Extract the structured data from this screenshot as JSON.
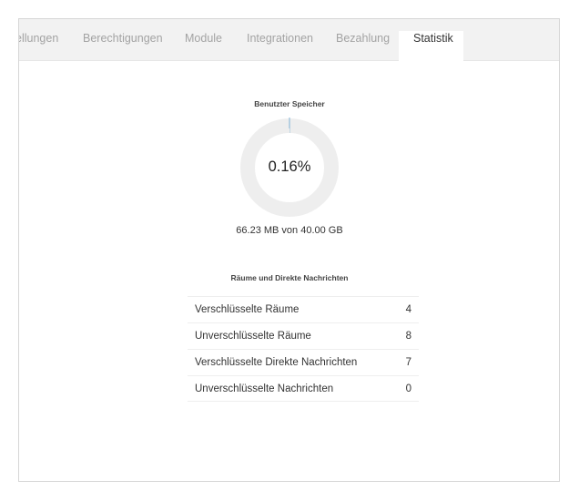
{
  "tabs": [
    {
      "label": "ellungen",
      "active": false
    },
    {
      "label": "Berechtigungen",
      "active": false
    },
    {
      "label": "Module",
      "active": false
    },
    {
      "label": "Integrationen",
      "active": false
    },
    {
      "label": "Bezahlung",
      "active": false
    },
    {
      "label": "Statistik",
      "active": true
    }
  ],
  "storage": {
    "title": "Benutzter Speicher",
    "percent_label": "0.16%",
    "percent_value": 0.16,
    "usage_text": "66.23 MB von 40.00 GB",
    "track_color": "#eeeeee",
    "fill_color": "#7fb3d5"
  },
  "rooms": {
    "title": "Räume und Direkte Nachrichten",
    "rows": [
      {
        "label": "Verschlüsselte Räume",
        "value": "4"
      },
      {
        "label": "Unverschlüsselte Räume",
        "value": "8"
      },
      {
        "label": "Verschlüsselte Direkte Nachrichten",
        "value": "7"
      },
      {
        "label": "Unverschlüsselte Nachrichten",
        "value": "0"
      }
    ]
  }
}
